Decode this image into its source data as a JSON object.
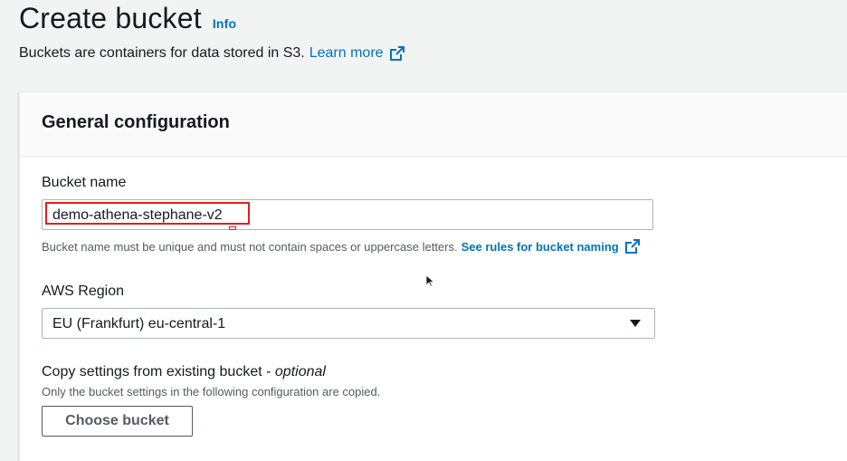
{
  "header": {
    "title": "Create bucket",
    "info_label": "Info",
    "subtitle": "Buckets are containers for data stored in S3.",
    "learn_more_label": "Learn more"
  },
  "general_config": {
    "title": "General configuration",
    "bucket_name": {
      "label": "Bucket name",
      "value": "demo-athena-stephane-v2",
      "help_text": "Bucket name must be unique and must not contain spaces or uppercase letters.",
      "rules_link_label": "See rules for bucket naming"
    },
    "region": {
      "label": "AWS Region",
      "selected": "EU (Frankfurt) eu-central-1"
    },
    "copy_settings": {
      "label": "Copy settings from existing bucket -",
      "label_optional": "optional",
      "description": "Only the bucket settings in the following configuration are copied.",
      "button_label": "Choose bucket"
    }
  },
  "icons": {
    "external_link": "external-link-icon",
    "dropdown": "caret-down-icon",
    "cursor": "mouse-pointer-icon"
  },
  "colors": {
    "link": "#0073bb",
    "highlight": "#e02020"
  }
}
